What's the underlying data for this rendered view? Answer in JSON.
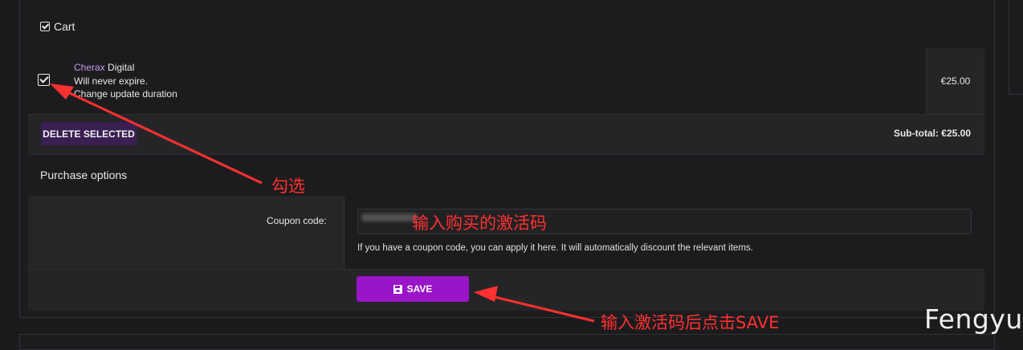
{
  "cart": {
    "title": "Cart",
    "item": {
      "brand": "Cherax",
      "name": " Digital",
      "expiry": "Will never expire.",
      "update_link": "Change update duration",
      "price": "€25.00",
      "checked": true
    },
    "delete_selected_label": "DELETE SELECTED",
    "subtotal": "Sub-total: €25.00"
  },
  "purchase_options": {
    "title": "Purchase options",
    "coupon_label": "Coupon code:",
    "coupon_help": "If you have a coupon code, you can apply it here. It will automatically discount the relevant items.",
    "save_label": "SAVE",
    "save_icon": "floppy-disk-icon"
  },
  "annotations": {
    "check": "勾选",
    "enter_code": "输入购买的激活码",
    "click_save": "输入激活码后点击SAVE",
    "color": "#ff3030"
  },
  "watermark": "Fengyu",
  "colors": {
    "accent": "#9a14c8",
    "brand": "#c39be8",
    "delete_button": "#3a1f52"
  }
}
